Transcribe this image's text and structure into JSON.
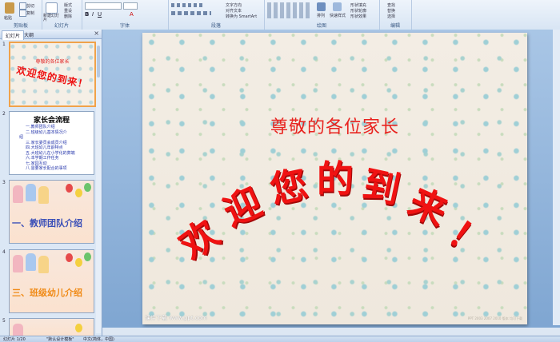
{
  "ribbon": {
    "groups": [
      {
        "label": "剪贴板",
        "buttons": [
          "粘贴",
          "剪切",
          "复制",
          "格式刷"
        ]
      },
      {
        "label": "幻灯片",
        "buttons": [
          "新建幻灯片",
          "版式",
          "重设",
          "删除"
        ]
      },
      {
        "label": "字体",
        "buttons": []
      },
      {
        "label": "段落",
        "buttons": [
          "文字方向",
          "对齐文本",
          "转换为 SmartArt"
        ]
      },
      {
        "label": "绘图",
        "buttons": [
          "排列",
          "快速样式",
          "形状填充",
          "形状轮廓",
          "形状效果"
        ]
      },
      {
        "label": "编辑",
        "buttons": [
          "查找",
          "替换",
          "选择"
        ]
      }
    ]
  },
  "panel": {
    "tabs": [
      "幻灯片",
      "大纲"
    ],
    "close": "×"
  },
  "thumbnails": [
    {
      "num": "1",
      "subtitle": "尊敬的各位家长",
      "title": "欢迎您的到来！"
    },
    {
      "num": "2",
      "heading": "家长会流程",
      "lines": [
        "一.教师团队介绍",
        "二.班级幼儿基本情况介",
        "绍",
        "三.家长委员会成员介绍",
        "四.大班幼儿年龄特点",
        "五.大班幼儿在小学化的弊端",
        "六.本学期工作任务",
        "七.家园互动",
        "八.需要家长配合的事项"
      ]
    },
    {
      "num": "3",
      "label": "一、教师团队介绍"
    },
    {
      "num": "4",
      "label": "三、班级幼儿介绍"
    },
    {
      "num": "5"
    }
  ],
  "slide": {
    "subtitle": "尊敬的各位家长",
    "arc_chars": [
      "欢",
      "迎",
      "您",
      "的",
      "到",
      "来",
      "！"
    ],
    "watermark": "课件下载 www.ppt.com",
    "fine_print": "PPT 2003 2007 2010 版本 均可下载"
  },
  "status": {
    "slide_info": "幻灯片 1/20",
    "theme": "\"默认设计模板\"",
    "language": "中文(简体，中国)"
  },
  "colors": {
    "accent_red": "#e8231f",
    "selection": "#f0a24a",
    "ribbon": "#d8e5f4"
  }
}
